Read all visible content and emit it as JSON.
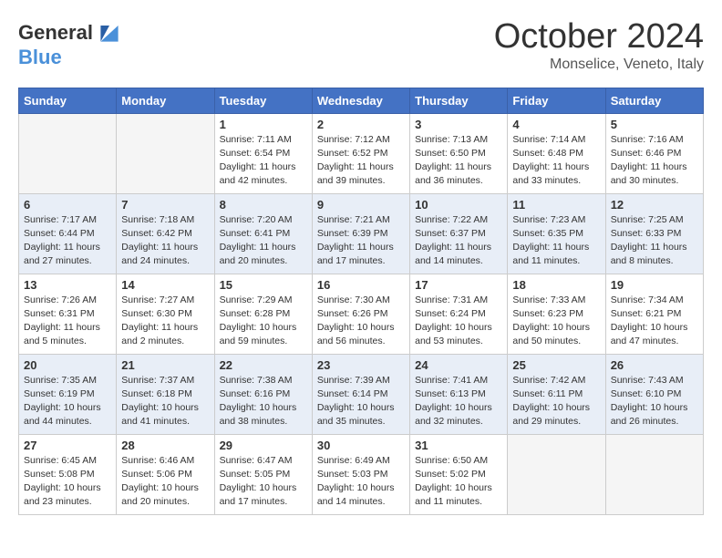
{
  "header": {
    "logo_general": "General",
    "logo_blue": "Blue",
    "month": "October 2024",
    "location": "Monselice, Veneto, Italy"
  },
  "days_of_week": [
    "Sunday",
    "Monday",
    "Tuesday",
    "Wednesday",
    "Thursday",
    "Friday",
    "Saturday"
  ],
  "weeks": [
    [
      {
        "day": "",
        "info": ""
      },
      {
        "day": "",
        "info": ""
      },
      {
        "day": "1",
        "info": "Sunrise: 7:11 AM\nSunset: 6:54 PM\nDaylight: 11 hours and 42 minutes."
      },
      {
        "day": "2",
        "info": "Sunrise: 7:12 AM\nSunset: 6:52 PM\nDaylight: 11 hours and 39 minutes."
      },
      {
        "day": "3",
        "info": "Sunrise: 7:13 AM\nSunset: 6:50 PM\nDaylight: 11 hours and 36 minutes."
      },
      {
        "day": "4",
        "info": "Sunrise: 7:14 AM\nSunset: 6:48 PM\nDaylight: 11 hours and 33 minutes."
      },
      {
        "day": "5",
        "info": "Sunrise: 7:16 AM\nSunset: 6:46 PM\nDaylight: 11 hours and 30 minutes."
      }
    ],
    [
      {
        "day": "6",
        "info": "Sunrise: 7:17 AM\nSunset: 6:44 PM\nDaylight: 11 hours and 27 minutes."
      },
      {
        "day": "7",
        "info": "Sunrise: 7:18 AM\nSunset: 6:42 PM\nDaylight: 11 hours and 24 minutes."
      },
      {
        "day": "8",
        "info": "Sunrise: 7:20 AM\nSunset: 6:41 PM\nDaylight: 11 hours and 20 minutes."
      },
      {
        "day": "9",
        "info": "Sunrise: 7:21 AM\nSunset: 6:39 PM\nDaylight: 11 hours and 17 minutes."
      },
      {
        "day": "10",
        "info": "Sunrise: 7:22 AM\nSunset: 6:37 PM\nDaylight: 11 hours and 14 minutes."
      },
      {
        "day": "11",
        "info": "Sunrise: 7:23 AM\nSunset: 6:35 PM\nDaylight: 11 hours and 11 minutes."
      },
      {
        "day": "12",
        "info": "Sunrise: 7:25 AM\nSunset: 6:33 PM\nDaylight: 11 hours and 8 minutes."
      }
    ],
    [
      {
        "day": "13",
        "info": "Sunrise: 7:26 AM\nSunset: 6:31 PM\nDaylight: 11 hours and 5 minutes."
      },
      {
        "day": "14",
        "info": "Sunrise: 7:27 AM\nSunset: 6:30 PM\nDaylight: 11 hours and 2 minutes."
      },
      {
        "day": "15",
        "info": "Sunrise: 7:29 AM\nSunset: 6:28 PM\nDaylight: 10 hours and 59 minutes."
      },
      {
        "day": "16",
        "info": "Sunrise: 7:30 AM\nSunset: 6:26 PM\nDaylight: 10 hours and 56 minutes."
      },
      {
        "day": "17",
        "info": "Sunrise: 7:31 AM\nSunset: 6:24 PM\nDaylight: 10 hours and 53 minutes."
      },
      {
        "day": "18",
        "info": "Sunrise: 7:33 AM\nSunset: 6:23 PM\nDaylight: 10 hours and 50 minutes."
      },
      {
        "day": "19",
        "info": "Sunrise: 7:34 AM\nSunset: 6:21 PM\nDaylight: 10 hours and 47 minutes."
      }
    ],
    [
      {
        "day": "20",
        "info": "Sunrise: 7:35 AM\nSunset: 6:19 PM\nDaylight: 10 hours and 44 minutes."
      },
      {
        "day": "21",
        "info": "Sunrise: 7:37 AM\nSunset: 6:18 PM\nDaylight: 10 hours and 41 minutes."
      },
      {
        "day": "22",
        "info": "Sunrise: 7:38 AM\nSunset: 6:16 PM\nDaylight: 10 hours and 38 minutes."
      },
      {
        "day": "23",
        "info": "Sunrise: 7:39 AM\nSunset: 6:14 PM\nDaylight: 10 hours and 35 minutes."
      },
      {
        "day": "24",
        "info": "Sunrise: 7:41 AM\nSunset: 6:13 PM\nDaylight: 10 hours and 32 minutes."
      },
      {
        "day": "25",
        "info": "Sunrise: 7:42 AM\nSunset: 6:11 PM\nDaylight: 10 hours and 29 minutes."
      },
      {
        "day": "26",
        "info": "Sunrise: 7:43 AM\nSunset: 6:10 PM\nDaylight: 10 hours and 26 minutes."
      }
    ],
    [
      {
        "day": "27",
        "info": "Sunrise: 6:45 AM\nSunset: 5:08 PM\nDaylight: 10 hours and 23 minutes."
      },
      {
        "day": "28",
        "info": "Sunrise: 6:46 AM\nSunset: 5:06 PM\nDaylight: 10 hours and 20 minutes."
      },
      {
        "day": "29",
        "info": "Sunrise: 6:47 AM\nSunset: 5:05 PM\nDaylight: 10 hours and 17 minutes."
      },
      {
        "day": "30",
        "info": "Sunrise: 6:49 AM\nSunset: 5:03 PM\nDaylight: 10 hours and 14 minutes."
      },
      {
        "day": "31",
        "info": "Sunrise: 6:50 AM\nSunset: 5:02 PM\nDaylight: 10 hours and 11 minutes."
      },
      {
        "day": "",
        "info": ""
      },
      {
        "day": "",
        "info": ""
      }
    ]
  ]
}
